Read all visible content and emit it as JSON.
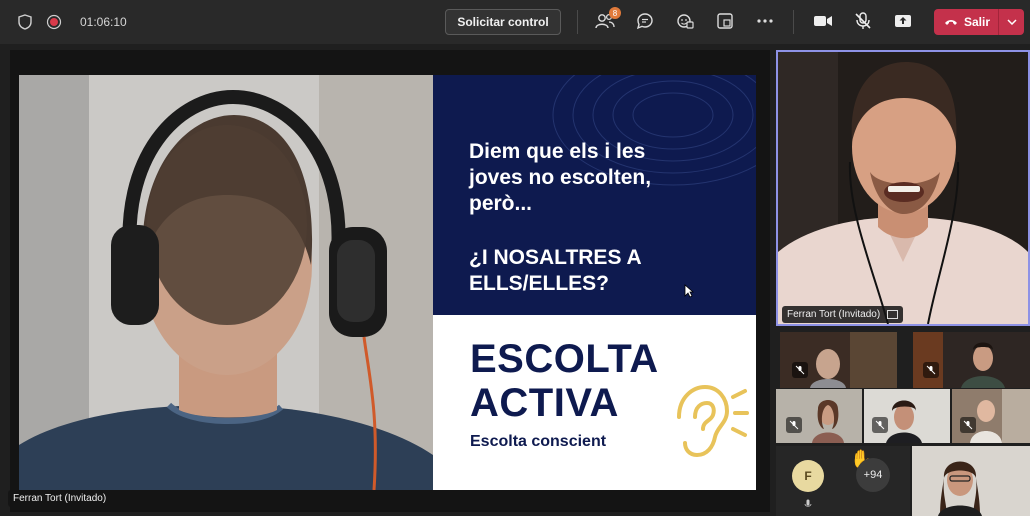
{
  "topbar": {
    "elapsed_time": "01:06:10",
    "request_control_label": "Solicitar control",
    "participants_badge": "8",
    "leave_label": "Salir",
    "colors": {
      "leave": "#c4314b",
      "badge": "#e07a3b",
      "active_border": "#8e92e6"
    }
  },
  "slide": {
    "statement_line1": "Diem que els i les",
    "statement_line2": "joves no escolten,",
    "statement_line3": "però...",
    "question_line1": "¿I NOSALTRES A",
    "question_line2": "ELLS/ELLES?",
    "brand_line1": "ESCOLTA",
    "brand_line2": "ACTIVA",
    "brand_subtitle": "Escolta conscient",
    "colors": {
      "navy": "#0e1a4f",
      "ear": "#e8c35a"
    }
  },
  "stage": {
    "presenter_name": "Ferran Tort (Invitado)"
  },
  "participants": {
    "active_speaker_name": "Ferran Tort (Invitado)",
    "avatar_initial": "F",
    "overflow_count": "+94"
  }
}
